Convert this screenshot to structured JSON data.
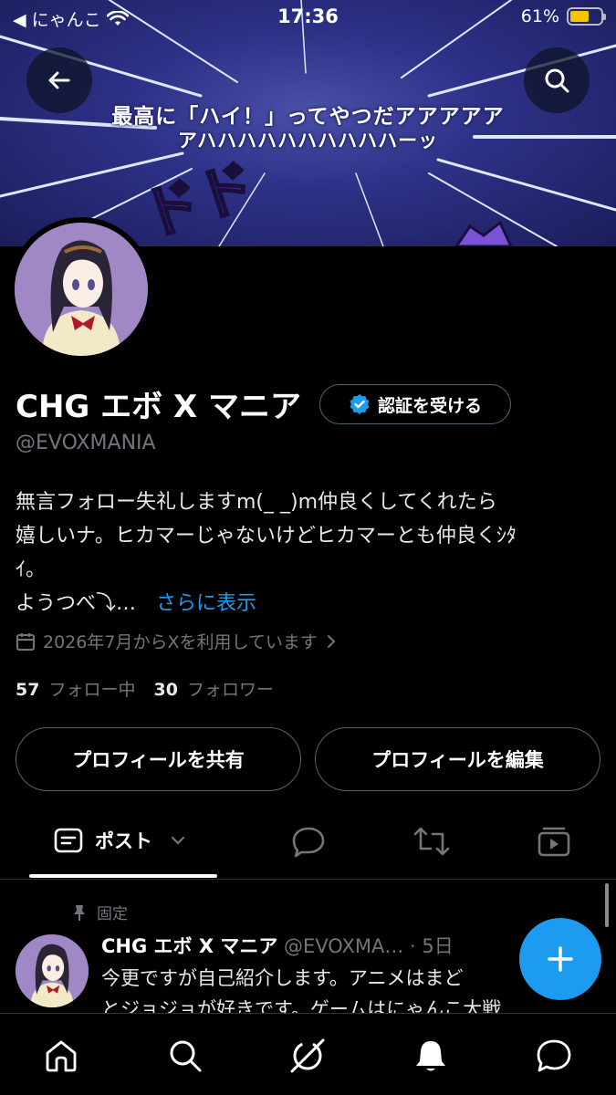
{
  "status_bar": {
    "carrier": "◀ にゃんこ",
    "time": "17:36",
    "battery_text": "61%",
    "battery_level": 0.61,
    "battery_color": "#f5c400"
  },
  "banner": {
    "line1": "最高に「ハイ！」ってやつだアアアアア",
    "line2": "アハハハハハハハハハハーッ",
    "effect_text": "ドド"
  },
  "header": {
    "back_icon": "arrow-left-icon",
    "search_icon": "search-icon"
  },
  "profile": {
    "name": "CHG エボ X マニア",
    "verify_label": "認証を受ける",
    "handle": "@EVOXMANIA",
    "bio_lines": [
      "無言フォロー失礼しますm(_ _)m仲良くしてくれたら",
      "嬉しいナ。ヒカマーじゃないけどヒカマーとも仲良くｼﾀ",
      "ｲ。",
      "ようつべ⤵…"
    ],
    "more_label": "さらに表示",
    "joined": "2026年7月からXを利用しています",
    "following_count": "57",
    "following_label": "フォロー中",
    "followers_count": "30",
    "followers_label": "フォロワー",
    "share_label": "プロフィールを共有",
    "edit_label": "プロフィールを編集"
  },
  "tabs": {
    "posts_label": "ポスト",
    "items": [
      "posts",
      "replies-icon",
      "reposts-icon",
      "media-icon"
    ]
  },
  "post": {
    "pinned_label": "固定",
    "author": "CHG エボ X マニア",
    "handle_time": "@EVOXMA… · 5日",
    "text_line1": "今更ですが自己紹介します。アニメはまど",
    "text_line2": "とジョジョが好きです。ゲームはにゃんこ大戦"
  },
  "colors": {
    "accent": "#1d9bf0",
    "muted": "#71767b",
    "border": "#2f3336"
  },
  "bottom_nav": [
    "home-icon",
    "search-icon",
    "grok-icon",
    "notifications-icon",
    "messages-icon"
  ]
}
